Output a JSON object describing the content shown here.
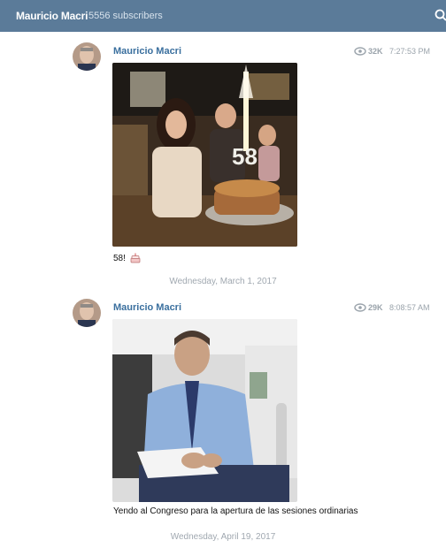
{
  "header": {
    "channel_name": "Mauricio Macri",
    "subscribers": "5556 subscribers"
  },
  "posts": [
    {
      "author": "Mauricio Macri",
      "views": "32K",
      "time": "7:27:53 PM",
      "caption": "58!"
    },
    {
      "author": "Mauricio Macri",
      "views": "29K",
      "time": "8:08:57 AM",
      "caption": "Yendo al Congreso para la apertura de las sesiones ordinarias"
    }
  ],
  "dates": [
    "Wednesday, March 1, 2017",
    "Wednesday, April 19, 2017"
  ],
  "colors": {
    "header": "#5b7b99",
    "author": "#3a6f9e",
    "meta": "#9aa3ab"
  },
  "icons": {
    "search": "search-icon",
    "views": "eye-icon"
  }
}
